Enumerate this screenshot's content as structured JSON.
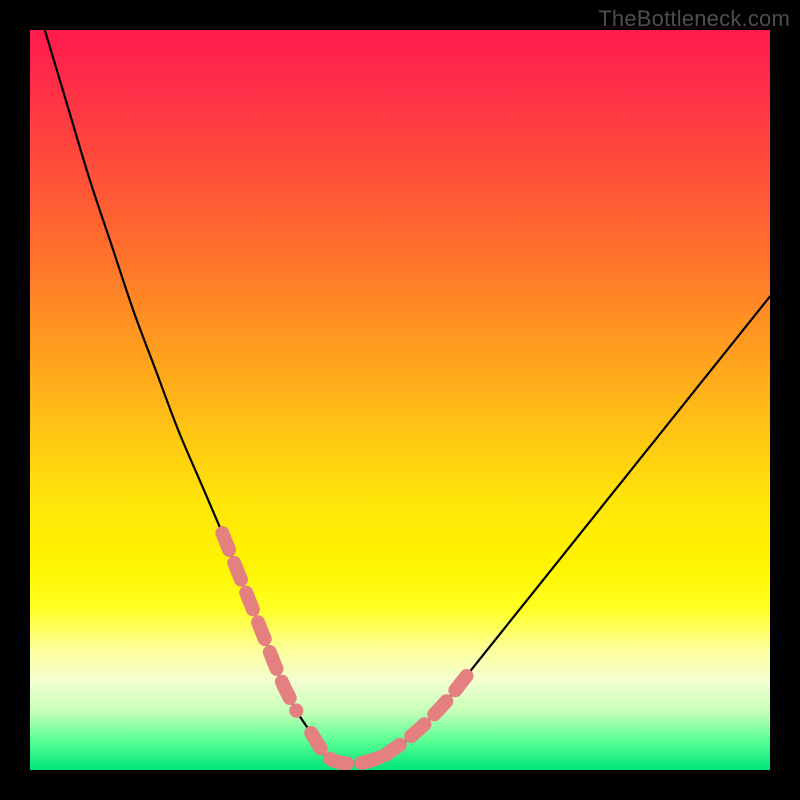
{
  "watermark": "TheBottleneck.com",
  "colors": {
    "frame": "#000000",
    "curve": "#000000",
    "segment_highlight": "#e48080",
    "gradient_top": "#ff1a4d",
    "gradient_bottom": "#00e57a"
  },
  "chart_data": {
    "type": "line",
    "title": "",
    "xlabel": "",
    "ylabel": "",
    "xlim": [
      0,
      100
    ],
    "ylim": [
      0,
      100
    ],
    "grid": false,
    "series": [
      {
        "name": "bottleneck-curve",
        "x": [
          2,
          5,
          8,
          11,
          14,
          17,
          20,
          23,
          26,
          28,
          30,
          32,
          34,
          36,
          38,
          40,
          42,
          45,
          48,
          52,
          56,
          60,
          64,
          68,
          72,
          76,
          80,
          84,
          88,
          92,
          96,
          100
        ],
        "y": [
          100,
          90,
          80,
          71,
          62,
          54,
          46,
          39,
          32,
          27,
          22,
          17,
          12,
          8,
          5,
          2,
          1,
          1,
          2,
          5,
          9,
          14,
          19,
          24,
          29,
          34,
          39,
          44,
          49,
          54,
          59,
          64
        ]
      }
    ],
    "highlighted_segments": [
      {
        "side": "left",
        "x": [
          26,
          28,
          30,
          32,
          34,
          36
        ],
        "y": [
          32,
          27,
          22,
          17,
          12,
          8
        ]
      },
      {
        "side": "valley",
        "x": [
          38,
          40,
          42,
          45,
          48
        ],
        "y": [
          5,
          2,
          1,
          1,
          2
        ]
      },
      {
        "side": "right",
        "x": [
          48,
          52,
          56,
          60
        ],
        "y": [
          2,
          5,
          9,
          14
        ]
      }
    ],
    "background_gradient_stops": [
      {
        "pos": 0.0,
        "color": "#ff1a4d"
      },
      {
        "pos": 0.28,
        "color": "#ff6a2e"
      },
      {
        "pos": 0.54,
        "color": "#ffc414"
      },
      {
        "pos": 0.78,
        "color": "#ffff20"
      },
      {
        "pos": 0.92,
        "color": "#c8ffb8"
      },
      {
        "pos": 1.0,
        "color": "#00e57a"
      }
    ]
  }
}
